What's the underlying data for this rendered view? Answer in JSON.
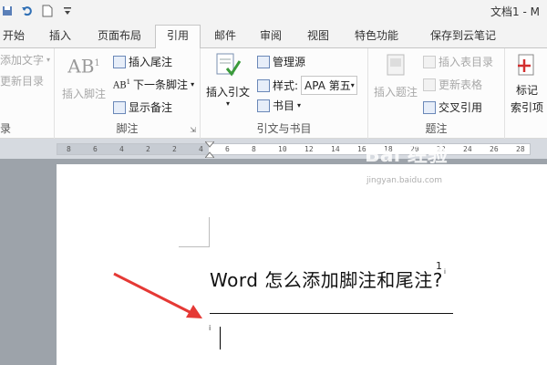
{
  "window": {
    "title": "文档1 - M"
  },
  "tabs": [
    "开始",
    "插入",
    "页面布局",
    "引用",
    "邮件",
    "审阅",
    "视图",
    "特色功能",
    "保存到云笔记"
  ],
  "active_tab": "引用",
  "ribbon": {
    "toc": {
      "add_text": "添加文字",
      "update_toc": "更新目录",
      "label": "录"
    },
    "footnotes": {
      "insert_footnote": "插入脚注",
      "ab_text": "AB",
      "ab_sup": "1",
      "ab_small": "AB",
      "ab_small_sup": "1",
      "insert_endnote": "插入尾注",
      "next_footnote": "下一条脚注",
      "show_notes": "显示备注",
      "label": "脚注"
    },
    "citations": {
      "insert_citation": "插入引文",
      "manage_sources": "管理源",
      "style_label": "样式:",
      "style_value": "APA 第五",
      "bibliography": "书目",
      "label": "引文与书目"
    },
    "captions": {
      "insert_caption": "插入题注",
      "insert_table_of_figures": "插入表目录",
      "update_table": "更新表格",
      "cross_reference": "交叉引用",
      "label": "题注"
    },
    "index": {
      "mark_entry": "标记",
      "mark_entry2": "索引项"
    }
  },
  "ruler": {
    "ticks": [
      "8",
      "6",
      "4",
      "2",
      "2",
      "4",
      "6",
      "8",
      "10",
      "12",
      "14",
      "16",
      "18",
      "20",
      "22",
      "24",
      "26",
      "28"
    ]
  },
  "document": {
    "heading": "Word 怎么添加脚注和尾注?",
    "footnote_ref": "1",
    "footnote_ref_mark": "i",
    "footnote_mark": "i"
  },
  "watermark": {
    "brand": "Bai 经验",
    "url": "jingyan.baidu.com"
  },
  "colors": {
    "accent_arrow": "#e53935",
    "page_bg": "#ffffff",
    "workspace_bg": "#9da3aa"
  }
}
